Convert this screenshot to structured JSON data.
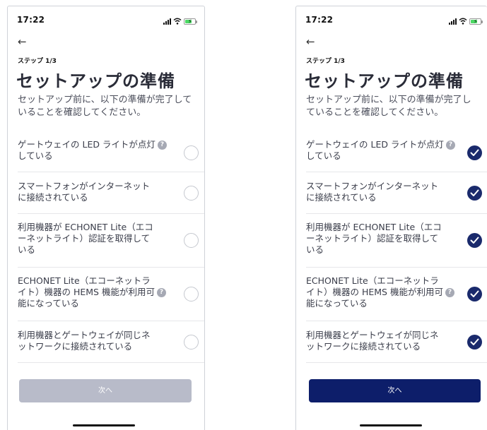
{
  "status_bar": {
    "time": "17:22"
  },
  "nav": {
    "back_icon": "←"
  },
  "step_label": "ステップ 1/3",
  "title": "セットアップの準備",
  "description": "セットアップ前に、以下の準備が完了していることを確認してください。",
  "help_icon": "?",
  "checklist": [
    {
      "line1": "ゲートウェイの LED ライトが点灯",
      "line2": "している",
      "line3": ""
    },
    {
      "line1": "スマートフォンがインターネット",
      "line2": "に接続されている",
      "line3": ""
    },
    {
      "line1": "利用機器が ECHONET Lite（エコ",
      "line2": "ーネットライト）認証を取得して",
      "line3": "いる"
    },
    {
      "line1": "ECHONET Lite（エコーネットラ",
      "line2": "イト）機器の HEMS 機能が利用可",
      "line3": "能になっている"
    },
    {
      "line1": "利用機器とゲートウェイが同じネ",
      "line2": "ットワークに接続されている",
      "line3": ""
    }
  ],
  "next_button": {
    "label": "次へ"
  },
  "screens": [
    {
      "name": "unchecked",
      "checked": [
        false,
        false,
        false,
        false,
        false
      ],
      "button_enabled": false
    },
    {
      "name": "checked",
      "checked": [
        true,
        true,
        true,
        true,
        true
      ],
      "button_enabled": true
    }
  ],
  "colors": {
    "accent": "#0d1e6a",
    "disabled": "#b8bbc9",
    "check_on": "#1a2a6c"
  }
}
